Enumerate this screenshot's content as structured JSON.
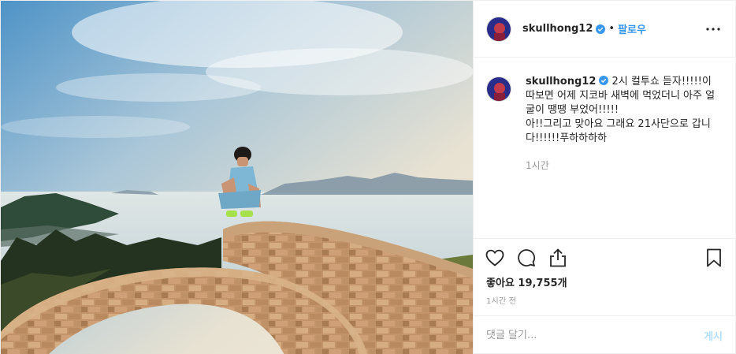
{
  "post": {
    "username": "skullhong12",
    "follow_label": "팔로우",
    "dot": "•",
    "caption_username": "skullhong12",
    "caption_text": "2시 컬투쇼 듣자!!!!!이따보면 어제 지코바 새벽에 먹었더니 아주 얼굴이 땡땡 부었어!!!!!\n아!!그리고 맞아요 그래요 21사단으로 갑니다!!!!!!푸하하하하",
    "caption_time": "1시간",
    "likes_label": "좋아요 19,755개",
    "time_ago": "1시간 전"
  },
  "comment": {
    "placeholder": "댓글 달기...",
    "post_label": "게시"
  },
  "icons": {
    "verified": "verified-badge-icon",
    "more": "more-options-icon",
    "like": "heart-icon",
    "comment": "comment-bubble-icon",
    "share": "share-icon",
    "save": "bookmark-icon"
  },
  "colors": {
    "accent": "#3897f0",
    "post_disabled": "#b2dffc",
    "muted": "#999999",
    "text": "#262626"
  }
}
